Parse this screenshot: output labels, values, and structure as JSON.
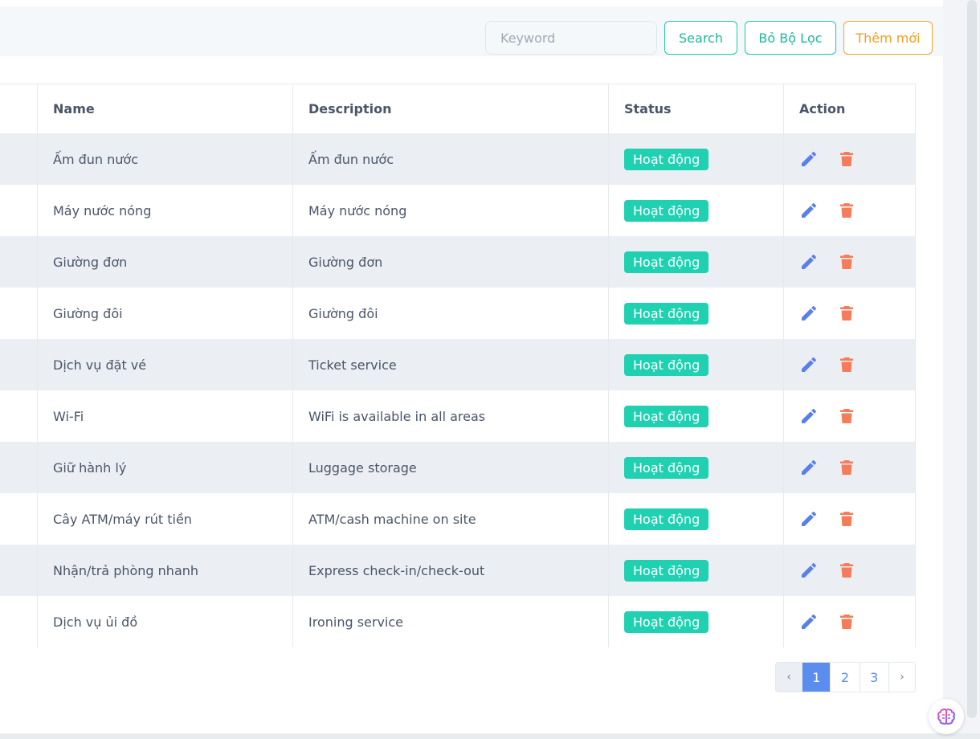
{
  "toolbar": {
    "keyword_placeholder": "Keyword",
    "keyword_value": "",
    "search_label": "Search",
    "reset_label": "Bỏ Bộ Lọc",
    "add_label": "Thêm mới"
  },
  "table": {
    "headers": {
      "name": "Name",
      "description": "Description",
      "status": "Status",
      "action": "Action"
    },
    "rows": [
      {
        "name": "Ấm đun nước",
        "description": "Ấm đun nước",
        "status": "Hoạt động"
      },
      {
        "name": "Máy nước nóng",
        "description": "Máy nước nóng",
        "status": "Hoạt động"
      },
      {
        "name": "Giường đơn",
        "description": "Giường đơn",
        "status": "Hoạt động"
      },
      {
        "name": "Giường đôi",
        "description": "Giường đôi",
        "status": "Hoạt động"
      },
      {
        "name": "Dịch vụ đặt vé",
        "description": "Ticket service",
        "status": "Hoạt động"
      },
      {
        "name": "Wi-Fi",
        "description": "WiFi is available in all areas",
        "status": "Hoạt động"
      },
      {
        "name": "Giữ hành lý",
        "description": "Luggage storage",
        "status": "Hoạt động"
      },
      {
        "name": "Cây ATM/máy rút tiền",
        "description": "ATM/cash machine on site",
        "status": "Hoạt động"
      },
      {
        "name": "Nhận/trả phòng nhanh",
        "description": "Express check-in/check-out",
        "status": "Hoạt động"
      },
      {
        "name": "Dịch vụ ủi đồ",
        "description": "Ironing service",
        "status": "Hoạt động"
      }
    ]
  },
  "pagination": {
    "prev": "‹",
    "pages": [
      "1",
      "2",
      "3"
    ],
    "current": "1",
    "next": "›"
  },
  "icons": {
    "edit": "pencil-icon",
    "delete": "trash-icon",
    "assistant": "brain-icon"
  },
  "colors": {
    "accent_teal": "#1fc7a8",
    "accent_orange": "#f5a623",
    "status_badge": "#1fd1b1",
    "edit_icon": "#5b7fe8",
    "delete_icon": "#f47c5a",
    "page_active": "#5b8def"
  }
}
